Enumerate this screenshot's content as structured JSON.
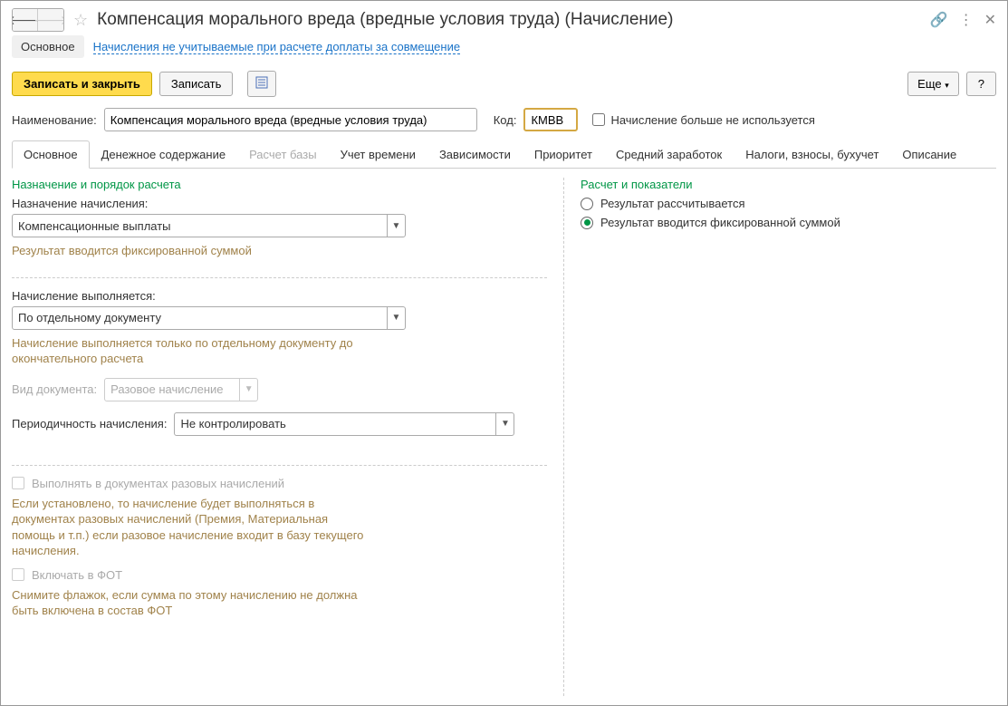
{
  "header": {
    "title": "Компенсация морального вреда (вредные условия труда) (Начисление)"
  },
  "linkbar": {
    "main": "Основное",
    "link": "Начисления не учитываемые при расчете доплаты за совмещение"
  },
  "toolbar": {
    "save_close": "Записать и закрыть",
    "save": "Записать",
    "more": "Еще",
    "help": "?"
  },
  "fields": {
    "name_label": "Наименование:",
    "name_value": "Компенсация морального вреда (вредные условия труда)",
    "code_label": "Код:",
    "code_value": "КМВВ",
    "no_use_label": "Начисление больше не используется"
  },
  "tabs": [
    "Основное",
    "Денежное содержание",
    "Расчет базы",
    "Учет времени",
    "Зависимости",
    "Приоритет",
    "Средний заработок",
    "Налоги, взносы, бухучет",
    "Описание"
  ],
  "left": {
    "section_title": "Назначение и порядок расчета",
    "purpose_label": "Назначение начисления:",
    "purpose_value": "Компенсационные выплаты",
    "purpose_hint": "Результат вводится фиксированной суммой",
    "exec_label": "Начисление выполняется:",
    "exec_value": "По отдельному документу",
    "exec_hint": "Начисление выполняется только по отдельному документу до окончательного расчета",
    "doc_type_label": "Вид документа:",
    "doc_type_value": "Разовое начисление",
    "period_label": "Периодичность начисления:",
    "period_value": "Не контролировать",
    "cb1_label": "Выполнять в документах разовых начислений",
    "cb1_hint": "Если установлено, то начисление будет выполняться в документах разовых начислений (Премия, Материальная помощь и т.п.) если разовое начисление входит в базу текущего начисления.",
    "cb2_label": "Включать в ФОТ",
    "cb2_hint": "Снимите флажок, если сумма по этому начислению не должна быть включена в состав ФОТ"
  },
  "right": {
    "section_title": "Расчет и показатели",
    "radio1": "Результат рассчитывается",
    "radio2": "Результат вводится фиксированной суммой"
  }
}
